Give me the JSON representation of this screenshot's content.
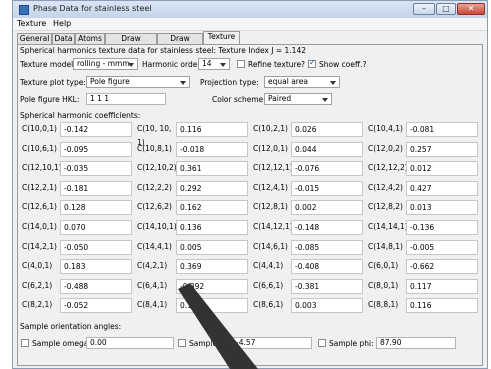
{
  "window": {
    "title": "Phase Data for stainless steel"
  },
  "menu": [
    "Texture",
    "Help"
  ],
  "tabs": [
    "General",
    "Data",
    "Atoms",
    "Draw Options",
    "Draw Atoms",
    "Texture"
  ],
  "panel": {
    "summary": "Spherical harmonics texture data for stainless steel: Texture Index J =  1.142",
    "texture_model_label": "Texture model:",
    "texture_model_value": "rolling - mmm",
    "harmonic_order_label": "Harmonic order:",
    "harmonic_order_value": "14",
    "refine_label": "Refine texture?",
    "refine_checked": false,
    "show_coeff_label": "Show coeff.?",
    "show_coeff_checked": true,
    "plot_type_label": "Texture plot type:",
    "plot_type_value": "Pole figure",
    "projection_label": "Projection type:",
    "projection_value": "equal area",
    "pole_hkl_label": "Pole figure HKL:",
    "pole_hkl_value": "1 1 1",
    "color_scheme_label": "Color scheme",
    "color_scheme_value": "Paired",
    "coef_header": "Spherical harmonic coefficients:",
    "coefficients": [
      [
        [
          "C(10,0,1)",
          "-0.142"
        ],
        [
          "C(10, 10, 1)",
          "0.116"
        ],
        [
          "C(10,2,1)",
          "0.026"
        ],
        [
          "C(10,4,1)",
          "-0.081"
        ]
      ],
      [
        [
          "C(10,6,1)",
          "-0.095"
        ],
        [
          "C(10,8,1)",
          "-0.018"
        ],
        [
          "C(12,0,1)",
          "0.044"
        ],
        [
          "C(12,0,2)",
          "0.257"
        ]
      ],
      [
        [
          "C(12,10,1)",
          "-0.035"
        ],
        [
          "C(12,10,2)",
          "0.361"
        ],
        [
          "C(12,12,1)",
          "-0.076"
        ],
        [
          "C(12,12,2)",
          "0.012"
        ]
      ],
      [
        [
          "C(12,2,1)",
          "-0.181"
        ],
        [
          "C(12,2,2)",
          "0.292"
        ],
        [
          "C(12,4,1)",
          "-0.015"
        ],
        [
          "C(12,4,2)",
          "0.427"
        ]
      ],
      [
        [
          "C(12,6,1)",
          "0.128"
        ],
        [
          "C(12,6,2)",
          "0.162"
        ],
        [
          "C(12,8,1)",
          "0.002"
        ],
        [
          "C(12,8,2)",
          "0.013"
        ]
      ],
      [
        [
          "C(14,0,1)",
          "0.070"
        ],
        [
          "C(14,10,1)",
          "0.136"
        ],
        [
          "C(14,12,1)",
          "-0.148"
        ],
        [
          "C(14,14,1)",
          "-0.136"
        ]
      ],
      [
        [
          "C(14,2,1)",
          "-0.050"
        ],
        [
          "C(14,4,1)",
          "0.005"
        ],
        [
          "C(14,6,1)",
          "-0.085"
        ],
        [
          "C(14,8,1)",
          "-0.005"
        ]
      ],
      [
        [
          "C(4,0,1)",
          "0.183"
        ],
        [
          "C(4,2,1)",
          "0.369"
        ],
        [
          "C(4,4,1)",
          "-0.408"
        ],
        [
          "C(6,0,1)",
          "-0.662"
        ]
      ],
      [
        [
          "C(6,2,1)",
          "-0.488"
        ],
        [
          "C(6,4,1)",
          "-0.392"
        ],
        [
          "C(6,6,1)",
          "-0.381"
        ],
        [
          "C(8,0,1)",
          "0.117"
        ]
      ],
      [
        [
          "C(8,2,1)",
          "-0.052"
        ],
        [
          "C(8,4,1)",
          "0.111"
        ],
        [
          "C(8,6,1)",
          "0.003"
        ],
        [
          "C(8,8,1)",
          "0.116"
        ]
      ]
    ],
    "orientation_header": "Sample orientation angles:",
    "sample_omega_label": "Sample omega:",
    "sample_omega_value": "0.00",
    "sample_chi_label": "Sample chi:",
    "sample_chi_value": "-4.57",
    "sample_phi_label": "Sample phi:",
    "sample_phi_value": "87.90"
  },
  "colors": {
    "title_bar": "#c3d4ea",
    "panel": "#f0f0f0",
    "close_button": "#c8463a",
    "overlay_arrow": "#333333"
  }
}
